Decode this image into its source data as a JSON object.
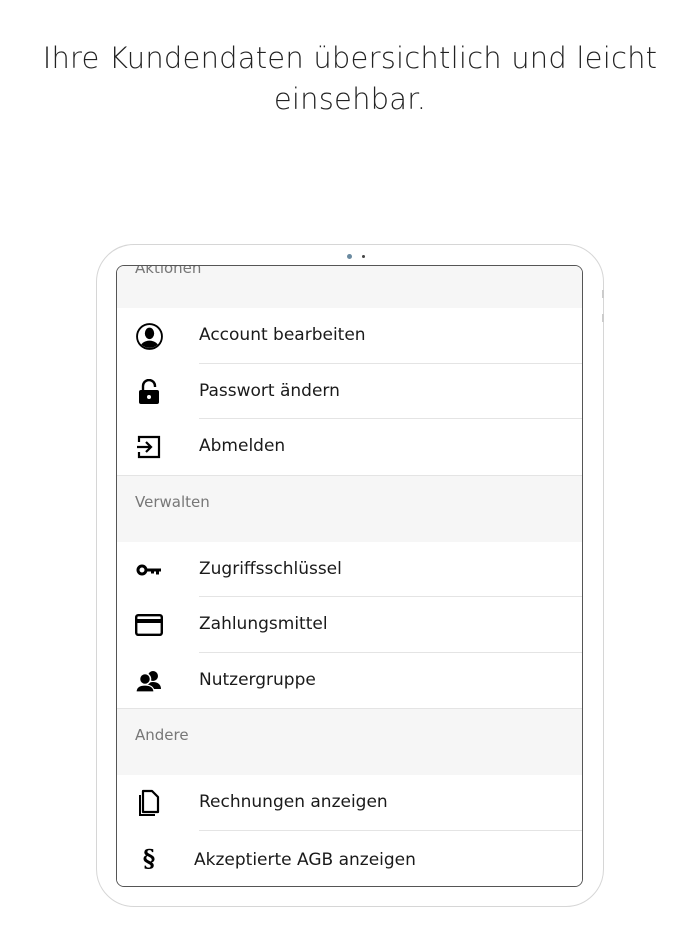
{
  "headline": "Ihre Kundendaten übersichtlich und leicht einsehbar.",
  "sections": [
    {
      "title": "Aktionen",
      "items": [
        {
          "label": "Account bearbeiten",
          "icon": "user-circle-icon"
        },
        {
          "label": "Passwort ändern",
          "icon": "lock-icon"
        },
        {
          "label": "Abmelden",
          "icon": "logout-icon"
        }
      ]
    },
    {
      "title": "Verwalten",
      "items": [
        {
          "label": "Zugriffsschlüssel",
          "icon": "key-icon"
        },
        {
          "label": "Zahlungsmittel",
          "icon": "credit-card-icon"
        },
        {
          "label": "Nutzergruppe",
          "icon": "user-group-icon"
        }
      ]
    },
    {
      "title": "Andere",
      "items": [
        {
          "label": "Rechnungen anzeigen",
          "icon": "documents-icon"
        },
        {
          "label": "Akzeptierte AGB anzeigen",
          "icon": "paragraph-icon",
          "glyph": "§"
        }
      ]
    }
  ]
}
